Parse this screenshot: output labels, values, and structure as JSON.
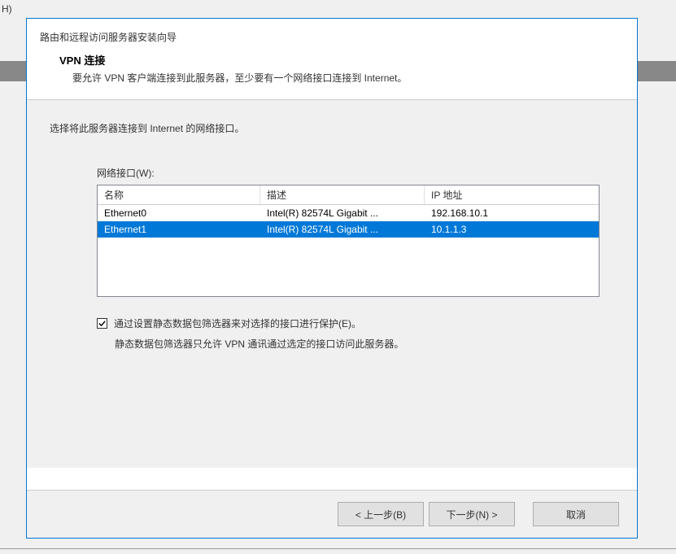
{
  "side_fragment": "H)",
  "wizard": {
    "window_title": "路由和远程访问服务器安装向导",
    "heading": "VPN 连接",
    "description": "要允许 VPN 客户端连接到此服务器，至少要有一个网络接口连接到 Internet。",
    "instruction": "选择将此服务器连接到 Internet 的网络接口。",
    "list_label": "网络接口(W):",
    "columns": {
      "name": "名称",
      "desc": "描述",
      "ip": "IP 地址"
    },
    "rows": [
      {
        "name": "Ethernet0",
        "desc": "Intel(R) 82574L Gigabit ...",
        "ip": "192.168.10.1",
        "selected": false
      },
      {
        "name": "Ethernet1",
        "desc": "Intel(R) 82574L Gigabit ...",
        "ip": "10.1.1.3",
        "selected": true
      }
    ],
    "checkbox": {
      "checked": true,
      "label": "通过设置静态数据包筛选器来对选择的接口进行保护(E)。"
    },
    "hint": "静态数据包筛选器只允许 VPN 通讯通过选定的接口访问此服务器。",
    "buttons": {
      "back": "< 上一步(B)",
      "next": "下一步(N) >",
      "cancel": "取消"
    }
  }
}
